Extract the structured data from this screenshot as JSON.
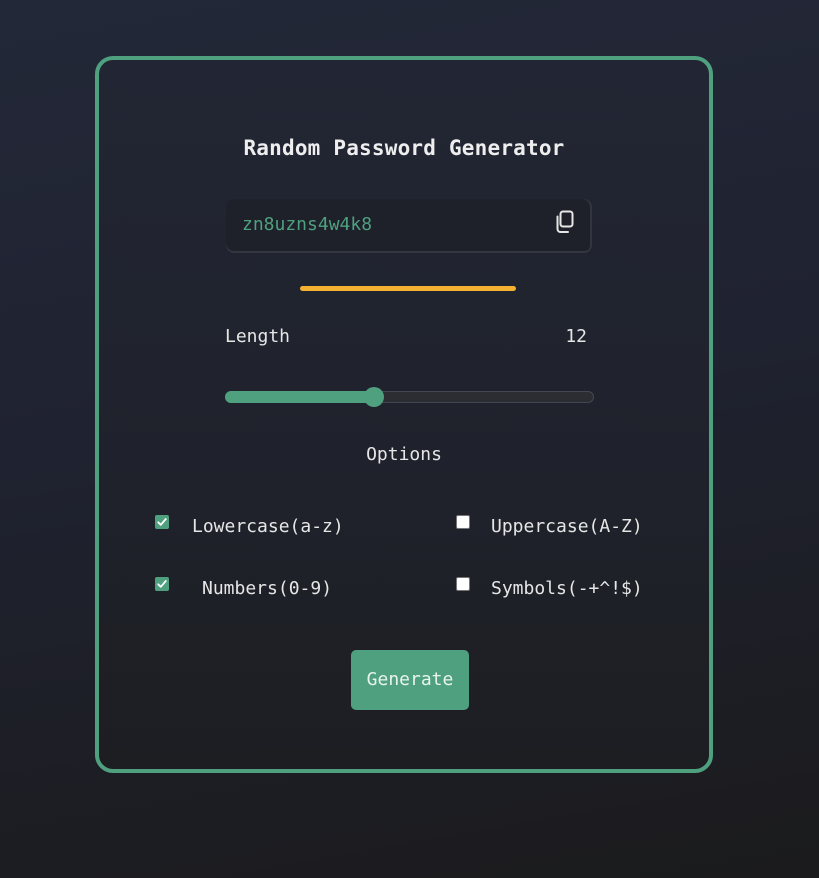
{
  "title": "Random Password Generator",
  "password": {
    "value": "zn8uzns4w4k8",
    "copy_icon": "copy-icon"
  },
  "strength": {
    "color": "#f5b132"
  },
  "length": {
    "label": "Length",
    "value": "12",
    "slider_fraction": 0.405
  },
  "options": {
    "title": "Options",
    "items": [
      {
        "label": "Lowercase(a-z)",
        "checked": true
      },
      {
        "label": "Uppercase(A-Z)",
        "checked": false
      },
      {
        "label": "Numbers(0-9)",
        "checked": true
      },
      {
        "label": "Symbols(-+^!$)",
        "checked": false
      }
    ]
  },
  "generate": {
    "label": "Generate"
  },
  "colors": {
    "accent": "#4fa07f",
    "strength_bar": "#f5b132"
  }
}
